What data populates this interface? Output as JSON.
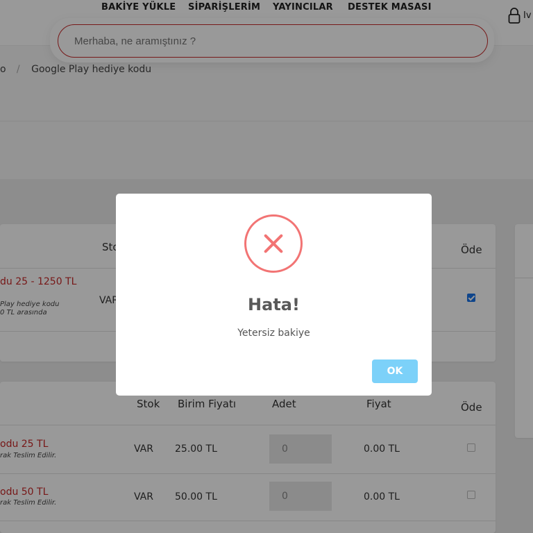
{
  "nav": {
    "items": [
      "BAKİYE YÜKLE",
      "SİPARİŞLERİM",
      "YAYINCILAR",
      "DESTEK MASASI"
    ],
    "user_label": "Iv"
  },
  "search": {
    "placeholder": "Merhaba, ne aramıştınız ?"
  },
  "breadcrumb": {
    "prefix": "o",
    "current": "Google Play hediye kodu"
  },
  "table1": {
    "headers": {
      "stock": "Sto",
      "pay": "Öde"
    },
    "row": {
      "name": "du 25 - 1250 TL",
      "desc_line1": "Play hediye kodu",
      "desc_line2": "0 TL arasında",
      "stock": "VAR",
      "checked": true
    }
  },
  "table2": {
    "headers": {
      "stock": "Stok",
      "unit_price": "Birim Fiyatı",
      "qty": "Adet",
      "price": "Fiyat",
      "pay": "Öde"
    },
    "rows": [
      {
        "name": "odu 25 TL",
        "desc": "rak Teslim Edilir.",
        "stock": "VAR",
        "unit_price": "25.00 TL",
        "qty": "0",
        "price": "0.00 TL",
        "checked": false
      },
      {
        "name": "odu 50 TL",
        "desc": "rak Teslim Edilir.",
        "stock": "VAR",
        "unit_price": "50.00 TL",
        "qty": "0",
        "price": "0.00 TL",
        "checked": false
      }
    ]
  },
  "modal": {
    "icon": "error-x-icon",
    "title": "Hata!",
    "text": "Yetersiz bakiye",
    "ok_label": "OK",
    "accent_color": "#f27474",
    "ok_color": "#7cd1f9"
  }
}
